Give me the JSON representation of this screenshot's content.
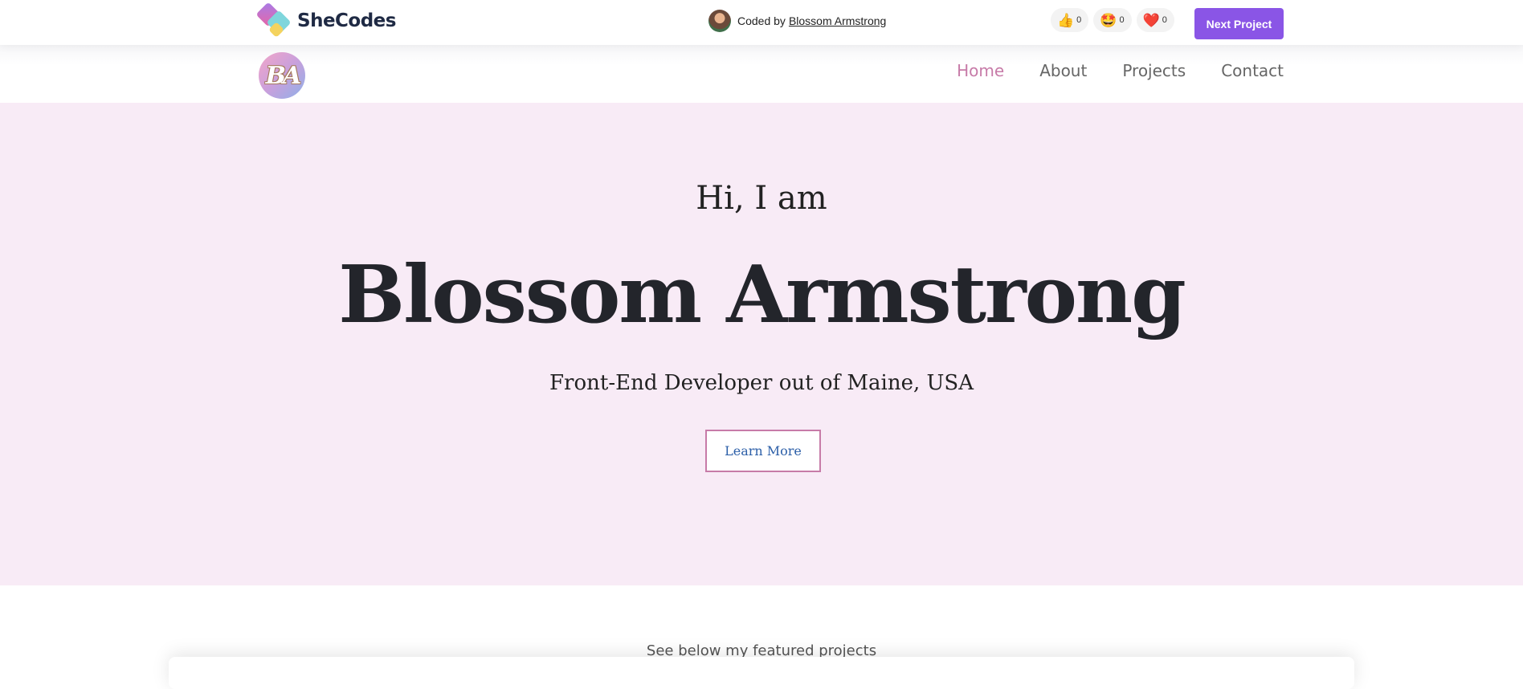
{
  "topbar": {
    "brand_name": "SheCodes",
    "coded_by_label": "Coded by",
    "author_name": "Blossom Armstrong",
    "reactions": [
      {
        "icon": "thumbs-up-icon",
        "emoji": "👍",
        "count": "0"
      },
      {
        "icon": "star-struck-icon",
        "emoji": "🤩",
        "count": "0"
      },
      {
        "icon": "heart-icon",
        "emoji": "❤️",
        "count": "0"
      }
    ],
    "next_project_label": "Next Project",
    "accent_color": "#8a55e6"
  },
  "nav": {
    "logo_text": "BA",
    "links": [
      {
        "label": "Home",
        "active": true
      },
      {
        "label": "About",
        "active": false
      },
      {
        "label": "Projects",
        "active": false
      },
      {
        "label": "Contact",
        "active": false
      }
    ],
    "active_color": "#c77ba8"
  },
  "hero": {
    "greeting": "Hi, I am",
    "name": "Blossom Armstrong",
    "subtitle": "Front-End Developer out of Maine, USA",
    "cta_label": "Learn More",
    "background_color": "#f8ebf6"
  },
  "featured": {
    "intro": "See below my featured projects"
  }
}
